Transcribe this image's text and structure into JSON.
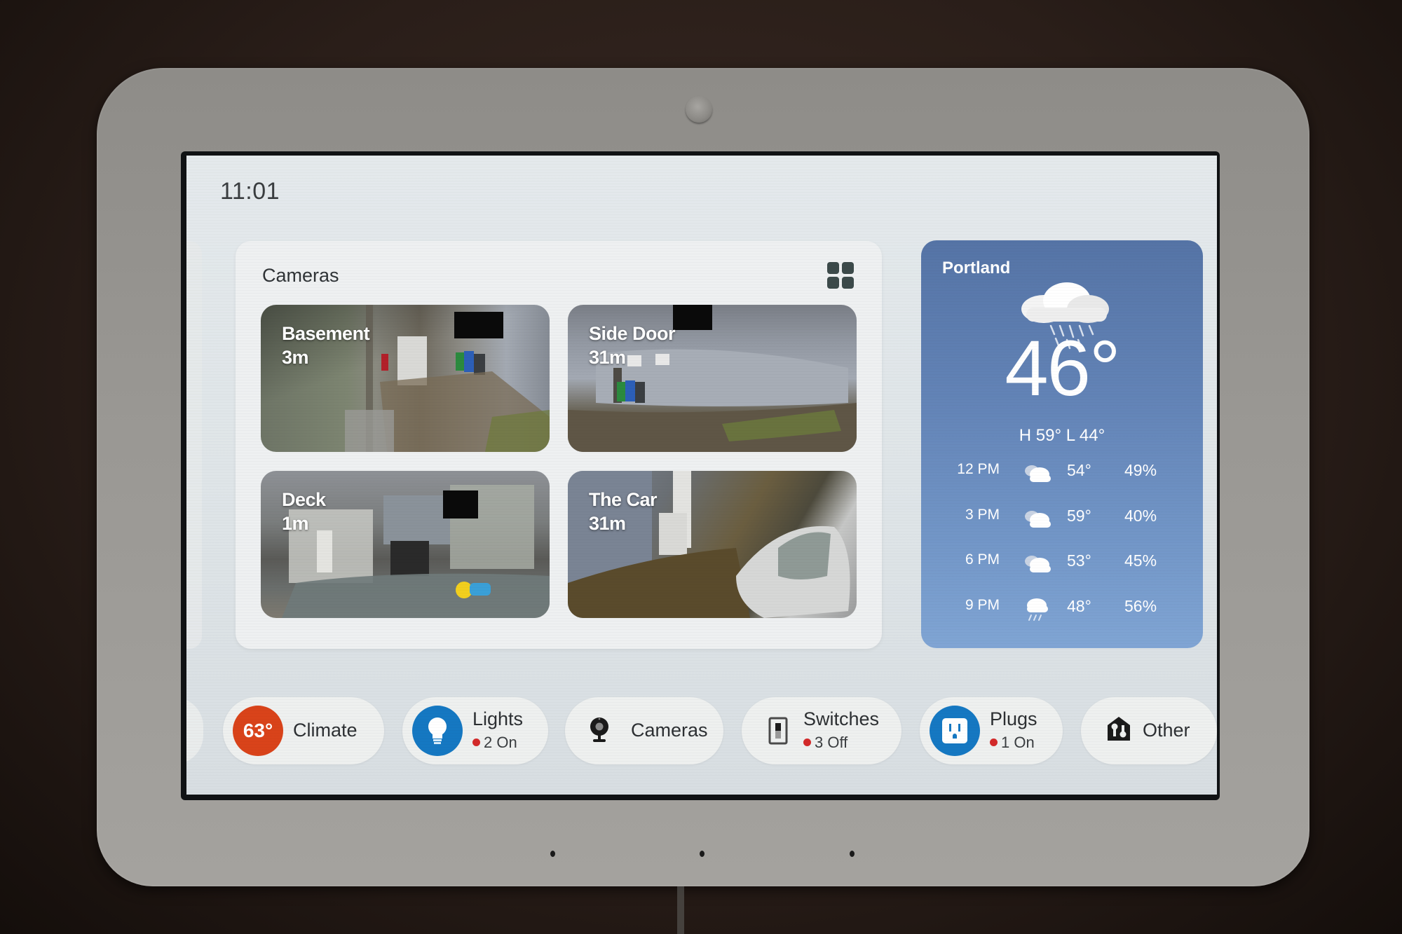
{
  "screen": {
    "time": "11:01"
  },
  "cameras_card": {
    "title": "Cameras",
    "layout_icon": "grid-view-icon",
    "tiles": [
      {
        "name": "Basement",
        "age": "3m"
      },
      {
        "name": "Side Door",
        "age": "31m"
      },
      {
        "name": "Deck",
        "age": "1m"
      },
      {
        "name": "The Car",
        "age": "31m"
      }
    ]
  },
  "weather": {
    "city": "Portland",
    "condition_icon": "rain-cloud-icon",
    "current_temp": "46°",
    "high_low": "H 59°  L 44°",
    "hourly": [
      {
        "time": "12 PM",
        "icon": "partly-cloudy-icon",
        "temp": "54°",
        "precip": "49%"
      },
      {
        "time": "3 PM",
        "icon": "partly-cloudy-icon",
        "temp": "59°",
        "precip": "40%"
      },
      {
        "time": "6 PM",
        "icon": "partly-cloudy-icon",
        "temp": "53°",
        "precip": "45%"
      },
      {
        "time": "9 PM",
        "icon": "rain-icon",
        "temp": "48°",
        "precip": "56%"
      }
    ]
  },
  "chips": [
    {
      "id": "climate",
      "label": "Climate",
      "badge_text": "63°",
      "badge_color": "#d9431a"
    },
    {
      "id": "lights",
      "label": "Lights",
      "status": "2 On",
      "badge_color": "#1578c2"
    },
    {
      "id": "cameras",
      "label": "Cameras"
    },
    {
      "id": "switches",
      "label": "Switches",
      "status": "3 Off"
    },
    {
      "id": "plugs",
      "label": "Plugs",
      "status": "1 On",
      "badge_color": "#1578c2"
    },
    {
      "id": "other",
      "label": "Other"
    }
  ],
  "colors": {
    "status_dot": "#d32a2a",
    "weather_bg": "#6384b7"
  }
}
